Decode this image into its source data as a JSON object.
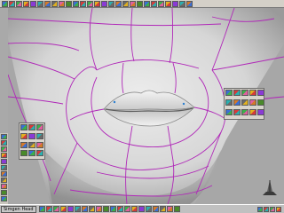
{
  "colors": {
    "viewport_bg": "#a7a7a7",
    "wireframe": "#b028b8",
    "toolbar_bg": "#d4d0c8",
    "taskbar_bg": "#c0c0c0"
  },
  "shelf": {
    "icons": [
      "select-icon",
      "move-icon",
      "rotate-icon",
      "scale-icon",
      "lasso-icon",
      "paint-icon",
      "split-icon",
      "extrude-icon",
      "bevel-icon",
      "mirror-icon",
      "weld-icon",
      "smooth-icon",
      "knife-icon",
      "bridge-icon",
      "camera-icon",
      "light-icon",
      "render-icon",
      "layer-icon",
      "grid-icon",
      "snap-icon",
      "undo-icon",
      "redo-icon",
      "save-icon",
      "open-icon",
      "new-icon",
      "help-icon",
      "close-icon"
    ]
  },
  "toolbox": {
    "icons": [
      "wand-icon",
      "brush-icon",
      "cut-icon",
      "eye-icon",
      "pencil-icon",
      "chain-icon",
      "magnet-icon",
      "hand-icon",
      "zoom-icon",
      "globe-icon",
      "cube-icon"
    ]
  },
  "palette_left": {
    "icons": [
      "curve-icon",
      "loop-icon",
      "ring-icon",
      "pencil-icon",
      "spray-icon",
      "cross-icon",
      "brush-icon",
      "drop-icon",
      "star-icon",
      "arrow-icon",
      "blob-icon",
      "pin-icon"
    ]
  },
  "palette_right": {
    "icons": [
      "leaf-icon",
      "bolt-icon",
      "brush-icon",
      "pin-icon",
      "globe-icon",
      "drop-icon",
      "cross-icon",
      "smooth-icon",
      "arrow-icon",
      "key-icon",
      "tag-icon",
      "lens-icon",
      "wrench-icon",
      "flag-icon",
      "link-icon"
    ]
  },
  "gizmo": {
    "label": "axis-gizmo"
  },
  "taskbar": {
    "start_label": "Simgen Head",
    "tasks": [
      "explorer-icon",
      "ie-icon",
      "mail-icon",
      "folder-icon",
      "app-icon",
      "paint-icon",
      "term-icon",
      "chat-icon",
      "media-icon",
      "doc-icon",
      "calc-icon",
      "game-icon",
      "web-icon",
      "mesh-icon",
      "render-icon",
      "zip-icon",
      "tool-icon",
      "net-icon",
      "vol-icon",
      "mail-icon"
    ],
    "tray": [
      "speaker-icon",
      "network-icon",
      "clock-icon",
      "shield-icon"
    ]
  }
}
